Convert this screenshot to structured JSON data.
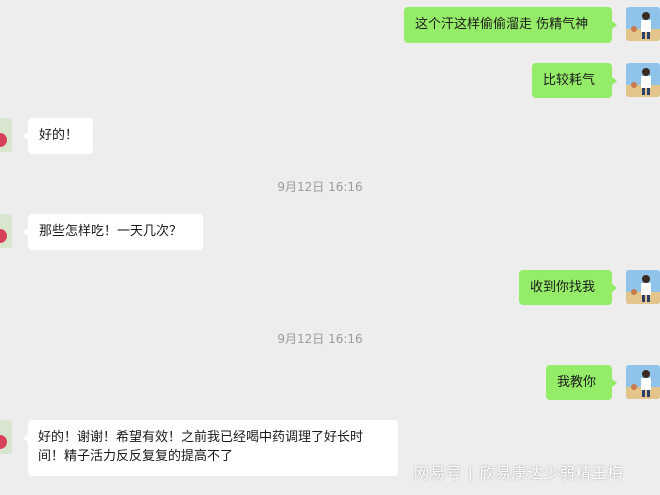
{
  "messages": [
    {
      "side": "right",
      "text": "这个汗这样偷偷溜走 伤精气神"
    },
    {
      "side": "right",
      "text": "比较耗气"
    },
    {
      "side": "left",
      "text": "好的！"
    },
    {
      "side": "left",
      "text": "那些怎样吃！一天几次？"
    },
    {
      "side": "right",
      "text": "收到你找我"
    },
    {
      "side": "right",
      "text": "我教你"
    },
    {
      "side": "left",
      "text": "好的！谢谢！希望有效！之前我已经喝中药调理了好长时间！精子活力反反复复的提高不了"
    }
  ],
  "timestamps": [
    "9月12日 16:16",
    "9月12日 16:16"
  ],
  "watermark": {
    "brand": "网易号",
    "separator": " | ",
    "author": "欣易康达少弱精王梅"
  },
  "colors": {
    "background": "#ededed",
    "self_bubble": "#95ec69",
    "other_bubble": "#ffffff",
    "timestamp": "#9b9b9b"
  },
  "icons": {
    "self_avatar": "user-avatar-person-photo",
    "other_avatar": "user-avatar-flower-photo"
  }
}
